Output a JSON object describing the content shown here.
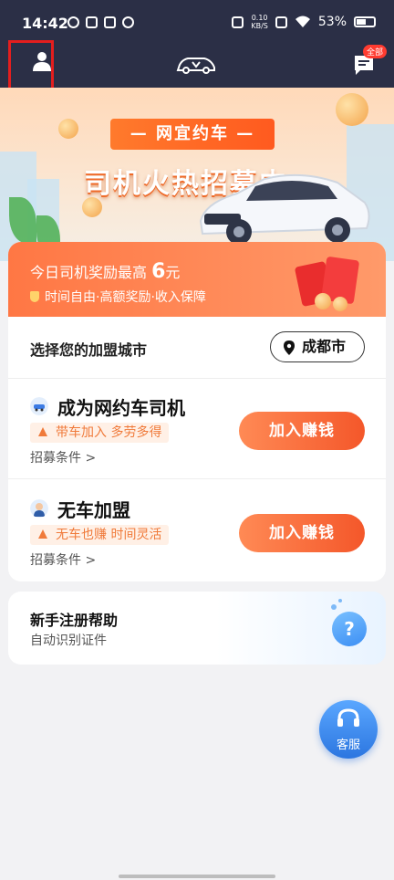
{
  "status_bar": {
    "time": "14:42",
    "net_speed_value": "0.10",
    "net_speed_unit": "KB/S",
    "battery": "53%"
  },
  "toolbar": {
    "badge": "全部"
  },
  "banner": {
    "subtitle": "— 网宜约车 —",
    "title": "司机火热招募中"
  },
  "reward": {
    "prefix": "今日司机奖励最高",
    "amount": "6",
    "unit": "元",
    "tagline": "时间自由·高额奖励·收入保障"
  },
  "city": {
    "label": "选择您的加盟城市",
    "value": "成都市"
  },
  "jobs": [
    {
      "title": "成为网约车司机",
      "tag": "带车加入 多劳多得",
      "condition": "招募条件 >",
      "button": "加入赚钱"
    },
    {
      "title": "无车加盟",
      "tag": "无车也赚 时间灵活",
      "condition": "招募条件 >",
      "button": "加入赚钱"
    }
  ],
  "help": {
    "title": "新手注册帮助",
    "subtitle": "自动识别证件",
    "icon_text": "?"
  },
  "service": {
    "label": "客服"
  },
  "colors": {
    "header_bg": "#2b2f46",
    "accent_orange": "#f4572a",
    "highlight_red": "#e41e1e",
    "service_blue": "#2c76e0"
  }
}
